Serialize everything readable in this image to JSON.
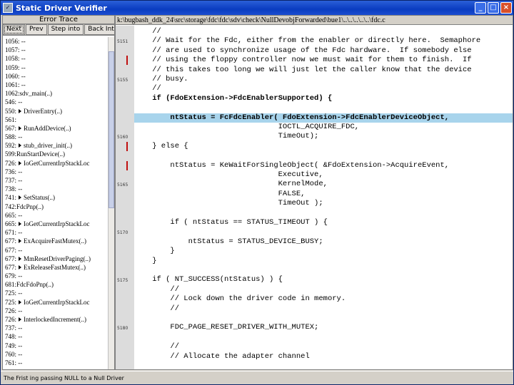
{
  "window": {
    "title": "Static Driver Verifier",
    "btn_min": "_",
    "btn_max": "□",
    "btn_close": "×"
  },
  "left_pane": {
    "header": "Error Trace",
    "buttons": [
      "Next",
      "Prev",
      "Step into",
      "Back Into"
    ],
    "trace": [
      {
        "text": "1056: --",
        "arrow": false
      },
      {
        "text": "1057: --",
        "arrow": false
      },
      {
        "text": "1058: --",
        "arrow": false
      },
      {
        "text": "1059: --",
        "arrow": false
      },
      {
        "text": "1060: --",
        "arrow": false
      },
      {
        "text": "1061: --",
        "arrow": false
      },
      {
        "text": "1062:sdv_main(..)",
        "arrow": false
      },
      {
        "text": "546: --",
        "arrow": false
      },
      {
        "text": "550:",
        "arrow": true,
        "label": "DriverEntry(..)"
      },
      {
        "text": "561:",
        "arrow": false
      },
      {
        "text": "567:",
        "arrow": true,
        "label": "RunAddDevice(..)"
      },
      {
        "text": "588: --",
        "arrow": false
      },
      {
        "text": "592:",
        "arrow": true,
        "label": "stub_driver_init(..)"
      },
      {
        "text": "599:RunStartDevice(..)",
        "arrow": false
      },
      {
        "text": "726:",
        "arrow": true,
        "label": "IoGetCurrentIrpStackLoc"
      },
      {
        "text": "736: --",
        "arrow": false
      },
      {
        "text": "737: --",
        "arrow": false
      },
      {
        "text": "738: --",
        "arrow": false
      },
      {
        "text": "741:",
        "arrow": true,
        "label": "SetStatus(..)"
      },
      {
        "text": "742:FdcPnp(..)",
        "arrow": false
      },
      {
        "text": "665: --",
        "arrow": false
      },
      {
        "text": "665:",
        "arrow": true,
        "label": "IoGetCurrentIrpStackLoc"
      },
      {
        "text": "671: --",
        "arrow": false
      },
      {
        "text": "677:",
        "arrow": true,
        "label": "ExAcquireFastMutex(..)"
      },
      {
        "text": "677: --",
        "arrow": false
      },
      {
        "text": "677:",
        "arrow": true,
        "label": "MmResetDriverPaging(..)"
      },
      {
        "text": "677:",
        "arrow": true,
        "label": "ExReleaseFastMutex(..)"
      },
      {
        "text": "679: --",
        "arrow": false
      },
      {
        "text": "681:FdcFdoPnp(..)",
        "arrow": false
      },
      {
        "text": "725: --",
        "arrow": false
      },
      {
        "text": "725:",
        "arrow": true,
        "label": "IoGetCurrentIrpStackLoc"
      },
      {
        "text": "726: --",
        "arrow": false
      },
      {
        "text": "726:",
        "arrow": true,
        "label": "InterlockedIncrement(..)"
      },
      {
        "text": "737: --",
        "arrow": false
      },
      {
        "text": "748: --",
        "arrow": false
      },
      {
        "text": "749: --",
        "arrow": false
      },
      {
        "text": "760: --",
        "arrow": false
      },
      {
        "text": "761: --",
        "arrow": false
      }
    ]
  },
  "editor": {
    "path": "k:\\bugbash_ddk_24\\src\\storage\\fdc\\fdc\\sdv\\check\\NullDevobjForwarded\\bue1\\..\\..\\..\\..\\..\\fdc.c",
    "lines": [
      {
        "no": "",
        "text": "    //",
        "cls": ""
      },
      {
        "no": "5151",
        "text": "    // Wait for the Fdc, either from the enabler or directly here.  Semaphore",
        "cls": ""
      },
      {
        "no": "",
        "text": "    // are used to synchronize usage of the Fdc hardware.  If somebody else",
        "cls": ""
      },
      {
        "no": "",
        "text": "    // using the floppy controller now we must wait for them to finish.  If",
        "cls": ""
      },
      {
        "no": "",
        "text": "    // this takes too long we will just let the caller know that the device",
        "cls": ""
      },
      {
        "no": "5155",
        "text": "    // busy.",
        "cls": ""
      },
      {
        "no": "",
        "text": "    //",
        "cls": ""
      },
      {
        "no": "",
        "text": "    if (FdoExtension->FdcEnablerSupported) {",
        "cls": "bold"
      },
      {
        "no": "",
        "text": "",
        "cls": ""
      },
      {
        "no": "",
        "text": "        ntStatus = FcFdcEnabler( FdoExtension->FdcEnablerDeviceObject,",
        "cls": "highlight bold"
      },
      {
        "no": "",
        "text": "                                IOCTL_ACQUIRE_FDC,",
        "cls": ""
      },
      {
        "no": "5160",
        "text": "                                TimeOut);",
        "cls": ""
      },
      {
        "no": "",
        "text": "    } else {",
        "cls": ""
      },
      {
        "no": "",
        "text": "",
        "cls": ""
      },
      {
        "no": "",
        "text": "        ntStatus = KeWaitForSingleObject( &FdoExtension->AcquireEvent,",
        "cls": ""
      },
      {
        "no": "",
        "text": "                                Executive,",
        "cls": ""
      },
      {
        "no": "5165",
        "text": "                                KernelMode,",
        "cls": ""
      },
      {
        "no": "",
        "text": "                                FALSE,",
        "cls": ""
      },
      {
        "no": "",
        "text": "                                TimeOut );",
        "cls": ""
      },
      {
        "no": "",
        "text": "",
        "cls": ""
      },
      {
        "no": "",
        "text": "        if ( ntStatus == STATUS_TIMEOUT ) {",
        "cls": ""
      },
      {
        "no": "5170",
        "text": "",
        "cls": ""
      },
      {
        "no": "",
        "text": "            ntStatus = STATUS_DEVICE_BUSY;",
        "cls": ""
      },
      {
        "no": "",
        "text": "        }",
        "cls": ""
      },
      {
        "no": "",
        "text": "    }",
        "cls": ""
      },
      {
        "no": "",
        "text": "",
        "cls": ""
      },
      {
        "no": "5175",
        "text": "    if ( NT_SUCCESS(ntStatus) ) {",
        "cls": ""
      },
      {
        "no": "",
        "text": "        //",
        "cls": ""
      },
      {
        "no": "",
        "text": "        // Lock down the driver code in memory.",
        "cls": ""
      },
      {
        "no": "",
        "text": "        //",
        "cls": ""
      },
      {
        "no": "",
        "text": "",
        "cls": ""
      },
      {
        "no": "5180",
        "text": "        FDC_PAGE_RESET_DRIVER_WITH_MUTEX;",
        "cls": ""
      },
      {
        "no": "",
        "text": "",
        "cls": ""
      },
      {
        "no": "",
        "text": "        //",
        "cls": ""
      },
      {
        "no": "",
        "text": "        // Allocate the adapter channel",
        "cls": ""
      }
    ],
    "red_marks": [
      3,
      12,
      14
    ]
  },
  "statusbar": {
    "text": "The Frist ing passing NULL to a Null Driver"
  }
}
